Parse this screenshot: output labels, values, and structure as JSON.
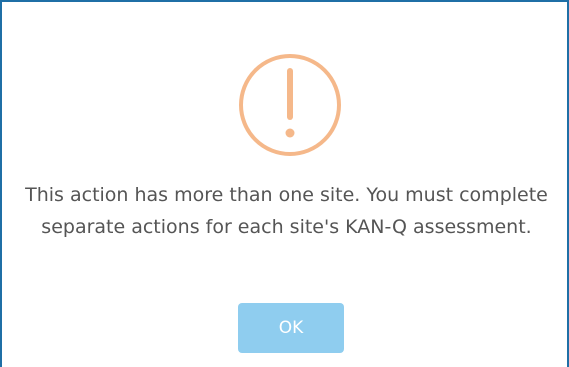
{
  "dialog": {
    "icon": "exclamation-circle-icon",
    "accent_color": "#f5b88a",
    "message": "This action has more than one site. You must complete separate actions for each site's KAN-Q assessment.",
    "ok_label": "OK",
    "button_color": "#8fcdef",
    "border_color": "#1f6fa6"
  }
}
